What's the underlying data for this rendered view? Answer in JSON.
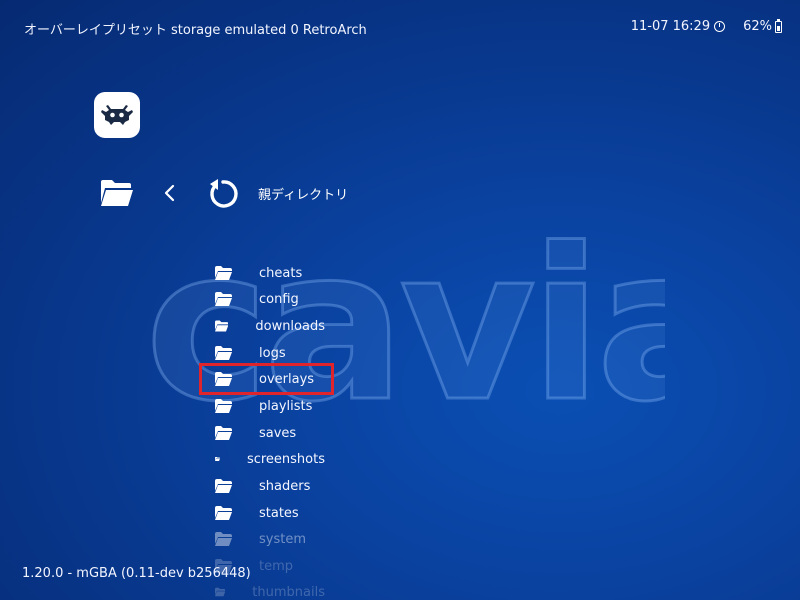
{
  "header": {
    "title": "オーバーレイプリセット  storage emulated 0 RetroArch",
    "datetime": "11-07 16:29",
    "battery": "62%"
  },
  "watermark": {
    "text": "cavia"
  },
  "nav": {
    "parent_label": "親ディレクトリ"
  },
  "files": {
    "items": [
      {
        "label": "cheats"
      },
      {
        "label": "config"
      },
      {
        "label": "downloads"
      },
      {
        "label": "logs"
      },
      {
        "label": "overlays"
      },
      {
        "label": "playlists"
      },
      {
        "label": "saves"
      },
      {
        "label": "screenshots"
      },
      {
        "label": "shaders"
      },
      {
        "label": "states"
      },
      {
        "label": "system"
      },
      {
        "label": "temp"
      },
      {
        "label": "thumbnails"
      }
    ],
    "selected": "overlays"
  },
  "footer": {
    "version": "1.20.0 - mGBA (0.11-dev b256448)"
  },
  "colors": {
    "background": "#0a42a0",
    "selection": "#e0242c",
    "text": "#ffffff"
  },
  "icons": {
    "app": "retroarch-logo-icon",
    "folder": "folder-icon",
    "back": "chevron-left-icon",
    "refresh": "refresh-icon",
    "clock": "clock-icon",
    "battery": "battery-icon"
  }
}
